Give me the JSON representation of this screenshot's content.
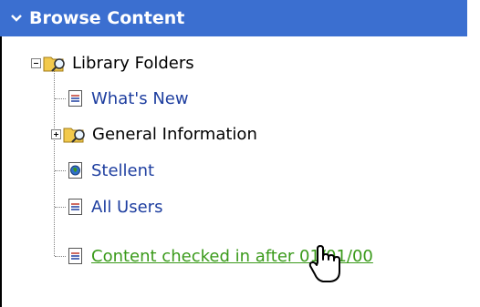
{
  "header": {
    "title": "Browse Content",
    "expand_icon": "chevron-down-icon"
  },
  "tree": {
    "root": {
      "label": "Library Folders",
      "icon": "library-folder-icon",
      "expanded": true
    },
    "items": [
      {
        "label": "What's New",
        "icon": "document-icon",
        "style": "blue"
      },
      {
        "label": "General Information",
        "icon": "library-folder-icon",
        "style": "black",
        "expandable": true
      },
      {
        "label": "Stellent",
        "icon": "web-document-icon",
        "style": "blue"
      },
      {
        "label": "All Users",
        "icon": "document-icon",
        "style": "blue"
      },
      {
        "label": "Content checked in after 01/01/00",
        "icon": "document-icon",
        "style": "green-hover"
      }
    ]
  },
  "colors": {
    "header_bg": "#3b6fd0",
    "link_blue": "#1f3fa0",
    "hover_green": "#3a9a1a"
  },
  "cursor": "hand-pointer-icon"
}
